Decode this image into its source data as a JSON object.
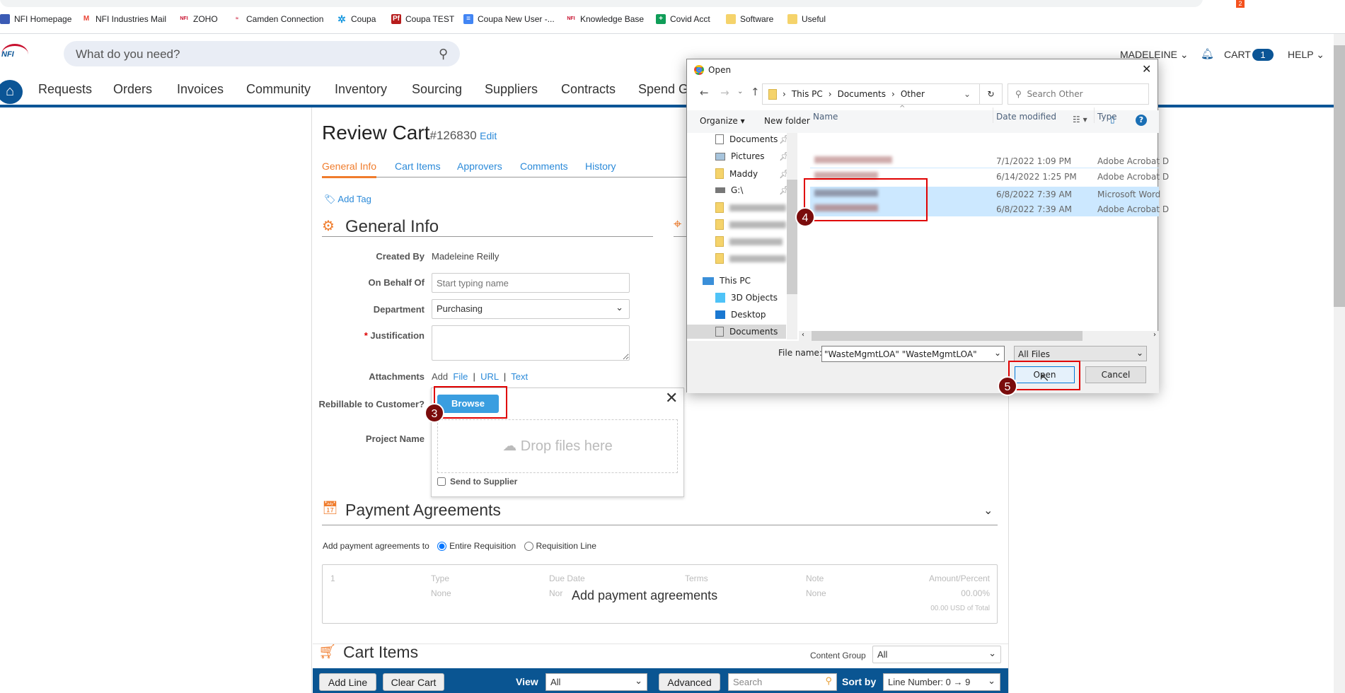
{
  "browser": {
    "bookmarks": [
      {
        "label": "NFI Homepage",
        "icon": "grid-icon",
        "color": "#3b5bb5"
      },
      {
        "label": "NFI Industries Mail",
        "icon": "gmail-icon",
        "color": "#ea4335"
      },
      {
        "label": "ZOHO",
        "icon": "nfi-icon",
        "color": "#c8102e"
      },
      {
        "label": "Camden Connection",
        "icon": "nfi-icon",
        "color": "#c8102e"
      },
      {
        "label": "Coupa",
        "icon": "coupa-icon",
        "color": "#1e9be0"
      },
      {
        "label": "Coupa TEST",
        "icon": "pf-icon",
        "color": "#b71c1c"
      },
      {
        "label": "Coupa New User -...",
        "icon": "docs-icon",
        "color": "#4285f4"
      },
      {
        "label": "Knowledge Base",
        "icon": "nfi-icon",
        "color": "#c8102e"
      },
      {
        "label": "Covid Acct",
        "icon": "sheets-icon",
        "color": "#0f9d58"
      },
      {
        "label": "Software",
        "icon": "folder-icon",
        "color": "#f5d36b"
      },
      {
        "label": "Useful",
        "icon": "folder-icon",
        "color": "#f5d36b"
      }
    ],
    "extension_badge": "2"
  },
  "header": {
    "logo": "NFI",
    "search_placeholder": "What do you need?",
    "user": "MADELEINE",
    "cart_label": "CART",
    "cart_count": "1",
    "help": "HELP"
  },
  "nav": [
    "Requests",
    "Orders",
    "Invoices",
    "Community",
    "Inventory",
    "Sourcing",
    "Suppliers",
    "Contracts",
    "Spend Gu"
  ],
  "page": {
    "title": "Review Cart",
    "number": "#126830",
    "edit": "Edit",
    "tabs": [
      "General Info",
      "Cart Items",
      "Approvers",
      "Comments",
      "History"
    ],
    "active_tab": 0,
    "add_tag": "Add Tag",
    "section_general": "General Info",
    "form": {
      "created_by_label": "Created By",
      "created_by": "Madeleine Reilly",
      "behalf_label": "On Behalf Of",
      "behalf_placeholder": "Start typing name",
      "department_label": "Department",
      "department": "Purchasing",
      "justification_label": "Justification",
      "required_mark": "*",
      "attachments_label": "Attachments",
      "add": "Add",
      "file": "File",
      "url": "URL",
      "text": "Text",
      "rebillable_label": "Rebillable to Customer?",
      "project_label": "Project Name"
    },
    "upload": {
      "browse": "Browse",
      "drop": "Drop files here",
      "send_to_supplier": "Send to Supplier",
      "send_checked": false
    },
    "payment": {
      "title": "Payment Agreements",
      "prompt": "Add payment agreements to",
      "options": [
        "Entire Requisition",
        "Requisition Line"
      ],
      "selected": 0,
      "table": {
        "index": "1",
        "headers": [
          "Type",
          "Due Date",
          "Terms",
          "Note",
          "Amount/Percent"
        ],
        "values": [
          "None",
          "Nor",
          "None",
          "00.00%"
        ],
        "total": "00.00 USD of Total",
        "overlay": "Add payment agreements"
      }
    },
    "cart_items": {
      "title": "Cart Items",
      "content_group_label": "Content Group",
      "content_group": "All",
      "toolbar": {
        "add_line": "Add Line",
        "clear_cart": "Clear Cart",
        "view_label": "View",
        "view": "All",
        "advanced": "Advanced",
        "search_placeholder": "Search",
        "sort_label": "Sort by",
        "sort": "Line Number: 0 → 9"
      }
    }
  },
  "dialog": {
    "title": "Open",
    "path": [
      "This PC",
      "Documents",
      "Other"
    ],
    "search_placeholder": "Search Other",
    "organize": "Organize",
    "new_folder": "New folder",
    "nav_items": [
      {
        "label": "Documents",
        "pinned": true
      },
      {
        "label": "Pictures",
        "pinned": true
      },
      {
        "label": "Maddy",
        "pinned": true
      },
      {
        "label": "G:\\",
        "pinned": true
      }
    ],
    "this_pc": "This PC",
    "pc_items": [
      "3D Objects",
      "Desktop",
      "Documents"
    ],
    "columns": [
      "Name",
      "Date modified",
      "Type"
    ],
    "files": [
      {
        "date": "7/1/2022 1:09 PM",
        "type": "Adobe Acrobat D",
        "selected": false
      },
      {
        "date": "6/14/2022 1:25 PM",
        "type": "Adobe Acrobat D",
        "selected": false
      },
      {
        "date": "6/8/2022 7:39 AM",
        "type": "Microsoft Word",
        "selected": true
      },
      {
        "date": "6/8/2022 7:39 AM",
        "type": "Adobe Acrobat D",
        "selected": true
      }
    ],
    "file_name_label": "File name:",
    "file_name": "\"WasteMgmtLOA\" \"WasteMgmtLOA\"",
    "filter": "All Files",
    "open": "Open",
    "cancel": "Cancel"
  },
  "annotations": [
    "3",
    "4",
    "5"
  ],
  "colors": {
    "brand_blue": "#0b5596",
    "link": "#2b8ad9",
    "active_tab": "#f07c2c",
    "annotation": "#7a0c0c",
    "highlight": "#e00000",
    "selection": "#cce8ff"
  }
}
